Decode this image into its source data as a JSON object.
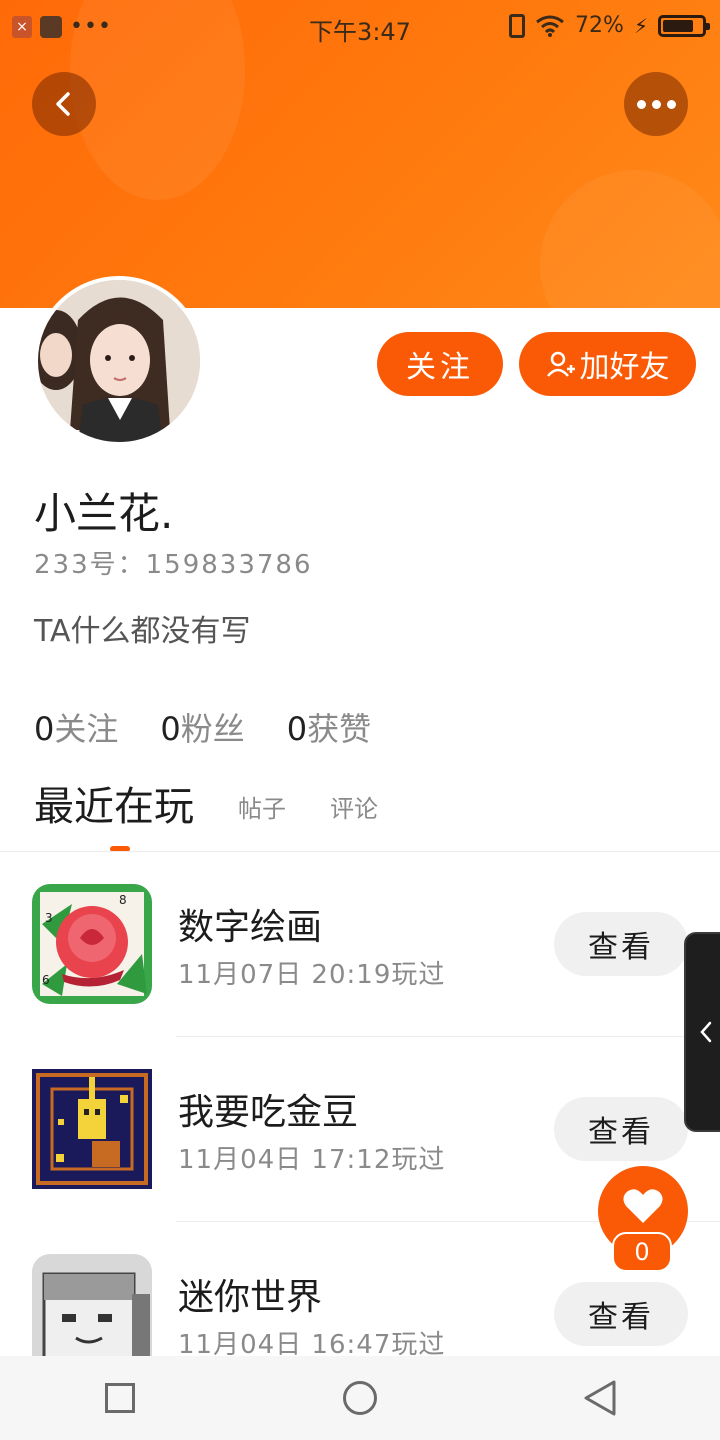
{
  "status_bar": {
    "time": "下午3:47",
    "battery_percent": "72%",
    "dots": "•••"
  },
  "profile": {
    "nickname": "小兰花.",
    "id_line": "233号：159833786",
    "bio": "TA什么都没有写"
  },
  "actions": {
    "follow_label": "关注",
    "add_friend_label": "加好友"
  },
  "stats": [
    {
      "num": "0",
      "label": "关注"
    },
    {
      "num": "0",
      "label": "粉丝"
    },
    {
      "num": "0",
      "label": "获赞"
    }
  ],
  "tabs": [
    {
      "label": "最近在玩",
      "active": true
    },
    {
      "label": "帖子",
      "active": false
    },
    {
      "label": "评论",
      "active": false
    }
  ],
  "games": [
    {
      "name": "数字绘画",
      "time": "11月07日 20:19玩过",
      "button": "查看",
      "icon": "rose-paint-icon"
    },
    {
      "name": "我要吃金豆",
      "time": "11月04日 17:12玩过",
      "button": "查看",
      "icon": "pixel-maze-icon"
    },
    {
      "name": "迷你世界",
      "time": "11月04日 16:47玩过",
      "button": "查看",
      "icon": "mini-world-icon"
    }
  ],
  "like": {
    "count": "0"
  },
  "colors": {
    "accent": "#fa5a05",
    "header": "#ff7a0e"
  }
}
